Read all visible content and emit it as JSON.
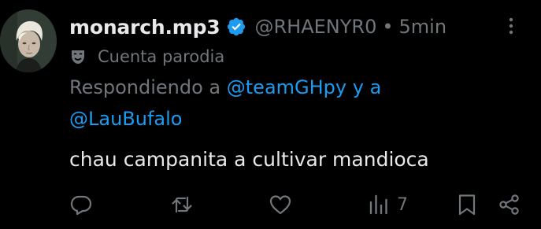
{
  "author": {
    "display_name": "monarch.mp3",
    "handle": "@RHAENYR0",
    "separator": "•",
    "time": "5min",
    "avatar_icon": "avatar-pale-hair-person",
    "verified_icon": "verified-badge-icon",
    "verified_color": "#1d9bf0"
  },
  "parody": {
    "icon": "theater-mask-icon",
    "label": "Cuenta parodia"
  },
  "reply": {
    "prefix": "Respondiendo a ",
    "mention1": "@teamGHpy",
    "connector": " y a",
    "mention2": "@LauBufalo"
  },
  "tweet": {
    "text": "chau campanita a cultivar mandioca"
  },
  "actions": {
    "reply_icon": "reply-bubble-icon",
    "retweet_icon": "retweet-icon",
    "like_icon": "heart-icon",
    "views_icon": "views-bar-chart-icon",
    "views_count": "7",
    "bookmark_icon": "bookmark-icon",
    "share_icon": "share-icon"
  },
  "colors": {
    "background": "#000000",
    "primary_text": "#e7e9ea",
    "secondary_text": "#71767b",
    "link": "#1d9bf0"
  }
}
